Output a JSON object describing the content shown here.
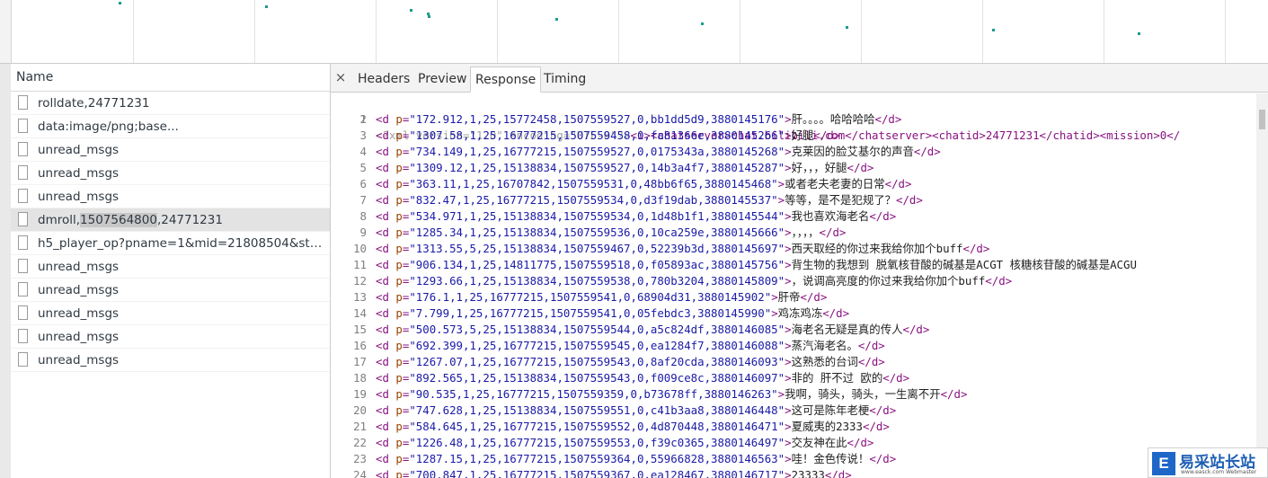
{
  "requests_pane": {
    "header": "Name",
    "items": [
      {
        "name": "rolldate,24771231"
      },
      {
        "name": "data:image/png;base..."
      },
      {
        "name": "unread_msgs"
      },
      {
        "name": "unread_msgs"
      },
      {
        "name": "unread_msgs"
      },
      {
        "name_pre": "dmroll,",
        "name_hl": "1507564800",
        "name_post": ",24771231",
        "selected": true
      },
      {
        "name": "h5_player_op?pname=1&mid=21808504&stat..."
      },
      {
        "name": "unread_msgs"
      },
      {
        "name": "unread_msgs"
      },
      {
        "name": "unread_msgs"
      },
      {
        "name": "unread_msgs"
      },
      {
        "name": "unread_msgs"
      }
    ]
  },
  "detail": {
    "close_glyph": "×",
    "tabs": [
      "Headers",
      "Preview",
      "Response",
      "Timing"
    ],
    "active_tab": "Response"
  },
  "response": {
    "header_line": {
      "n": 1,
      "pi": "<?xml version=\"1.0\" encoding=\"UTF-8\"?>",
      "rest": "<i><chatserver>chat.bilibili.com</chatserver><chatid>24771231</chatid><mission>0</"
    },
    "lines": [
      {
        "n": 2,
        "p": "172.912,1,25,15772458,1507559527,0,bb1dd5d9,3880145176",
        "text": "肝。。。。哈哈哈哈"
      },
      {
        "n": 3,
        "p": "1307.58,1,25,16777215,1507559458,0,fa81366e,3880145266",
        "text": "好腿"
      },
      {
        "n": 4,
        "p": "734.149,1,25,16777215,1507559527,0,0175343a,3880145268",
        "text": "克莱因的脸艾基尔的声音"
      },
      {
        "n": 5,
        "p": "1309.12,1,25,15138834,1507559527,0,14b3a4f7,3880145287",
        "text": "好，，，好腿"
      },
      {
        "n": 6,
        "p": "363.11,1,25,16707842,1507559531,0,48bb6f65,3880145468",
        "text": "或者老夫老妻的日常"
      },
      {
        "n": 7,
        "p": "832.47,1,25,16777215,1507559534,0,d3f19dab,3880145537",
        "text": "等等，是不是犯规了？"
      },
      {
        "n": 8,
        "p": "534.971,1,25,15138834,1507559534,0,1d48b1f1,3880145544",
        "text": "我也喜欢海老名"
      },
      {
        "n": 9,
        "p": "1285.34,1,25,15138834,1507559536,0,10ca259e,3880145666",
        "text": "，，，，"
      },
      {
        "n": 10,
        "p": "1313.55,5,25,15138834,1507559467,0,52239b3d,3880145697",
        "text": "西天取经的你过来我给你加个buff"
      },
      {
        "n": 11,
        "p": "906.134,1,25,14811775,1507559518,0,f05893ac,3880145756",
        "text": "背生物的我想到 脱氧核苷酸的碱基是ACGT 核糖核苷酸的碱基是ACGU",
        "noclose": true
      },
      {
        "n": 12,
        "p": "1293.66,1,25,15138834,1507559538,0,780b3204,3880145809",
        "text": "，说调高亮度的你过来我给你加个buff"
      },
      {
        "n": 13,
        "p": "176.1,1,25,16777215,1507559541,0,68904d31,3880145902",
        "text": "肝帝"
      },
      {
        "n": 14,
        "p": "7.799,1,25,16777215,1507559541,0,05febdc3,3880145990",
        "text": "鸡冻鸡冻"
      },
      {
        "n": 15,
        "p": "500.573,5,25,15138834,1507559544,0,a5c824df,3880146085",
        "text": "海老名无疑是真的传人"
      },
      {
        "n": 16,
        "p": "692.399,1,25,16777215,1507559545,0,ea1284f7,3880146088",
        "text": "蒸汽海老名。"
      },
      {
        "n": 17,
        "p": "1267.07,1,25,16777215,1507559543,0,8af20cda,3880146093",
        "text": "这熟悉的台词"
      },
      {
        "n": 18,
        "p": "892.565,1,25,15138834,1507559543,0,f009ce8c,3880146097",
        "text": "非的 肝不过 欧的"
      },
      {
        "n": 19,
        "p": "90.535,1,25,16777215,1507559359,0,b73678ff,3880146263",
        "text": "我啊，骑头，骑头，一生离不开"
      },
      {
        "n": 20,
        "p": "747.628,1,25,15138834,1507559551,0,c41b3aa8,3880146448",
        "text": "这可是陈年老梗"
      },
      {
        "n": 21,
        "p": "584.645,1,25,16777215,1507559552,0,4d870448,3880146471",
        "text": "夏威夷的2333"
      },
      {
        "n": 22,
        "p": "1226.48,1,25,16777215,1507559553,0,f39c0365,3880146497",
        "text": "交友神在此"
      },
      {
        "n": 23,
        "p": "1287.15,1,25,16777215,1507559364,0,55966828,3880146563",
        "text": "哇！金色传说！"
      },
      {
        "n": 24,
        "p": "700.847,1,25,16777215,1507559367,0,ea128467,3880146717",
        "text": "23333"
      }
    ]
  },
  "watermark": {
    "logo_letter": "E",
    "title": "易采站长站",
    "subtitle": "www.easck.com Webmaster"
  }
}
